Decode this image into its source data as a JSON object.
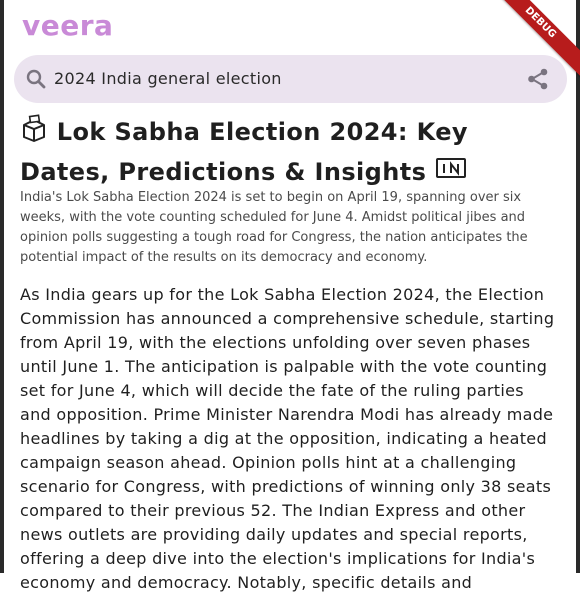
{
  "app": {
    "title": "veera",
    "debug_label": "DEBUG"
  },
  "search": {
    "query": "2024 India general election"
  },
  "icons": {
    "search": "search-icon",
    "share": "share-icon",
    "headline_leading": "ballot-box-icon",
    "headline_trailing": "india-flag-icon"
  },
  "article": {
    "headline": "Lok Sabha Election 2024: Key Dates, Predictions & Insights",
    "summary": "India's Lok Sabha Election 2024 is set to begin on April 19, spanning over six weeks, with the vote counting scheduled for June 4. Amidst political jibes and opinion polls suggesting a tough road for Congress, the nation anticipates the potential impact of the results on its democracy and economy.",
    "body": "As India gears up for the Lok Sabha Election 2024, the Election Commission has announced a comprehensive schedule, starting from April 19, with the elections unfolding over seven phases until June 1. The anticipation is palpable with the vote counting set for June 4, which will decide the fate of the ruling parties and opposition. Prime Minister Narendra Modi has already made headlines by taking a dig at the opposition, indicating a heated campaign season ahead. Opinion polls hint at a challenging scenario for Congress, with predictions of winning only 38 seats compared to their previous 52. The Indian Express and other news outlets are providing daily updates and special reports, offering a deep dive into the election's implications for India's economy and democracy. Notably, specific details and"
  },
  "colors": {
    "brand": "#c98ad7",
    "search_bg": "#ebe3ef",
    "debug": "#b71c1c"
  }
}
